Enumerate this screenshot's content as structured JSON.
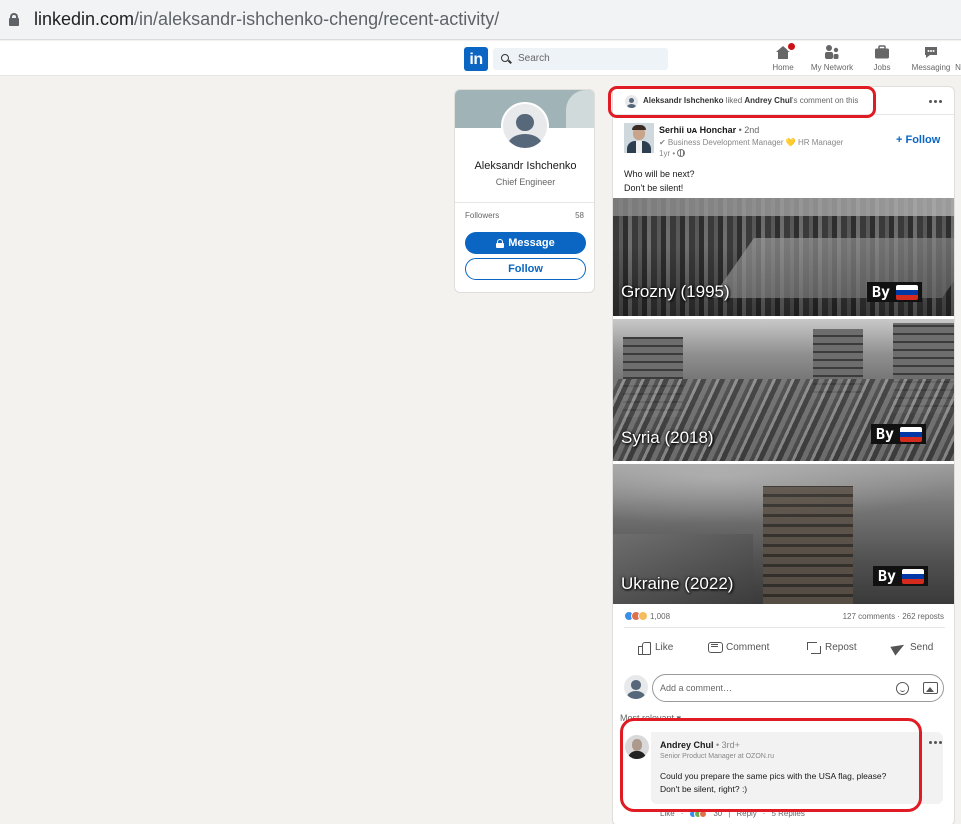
{
  "browser": {
    "url_host": "linkedin.com",
    "url_path": "/in/aleksandr-ishchenko-cheng/recent-activity/"
  },
  "nav": {
    "logo": "in",
    "search_placeholder": "Search",
    "items": [
      {
        "label": "Home",
        "icon": "home-icon",
        "badge": true
      },
      {
        "label": "My Network",
        "icon": "network-icon"
      },
      {
        "label": "Jobs",
        "icon": "briefcase-icon"
      },
      {
        "label": "Messaging",
        "icon": "messaging-icon"
      },
      {
        "label": "N",
        "icon": ""
      }
    ]
  },
  "profile": {
    "name": "Aleksandr Ishchenko",
    "title": "Chief Engineer",
    "followers_label": "Followers",
    "followers_count": "58",
    "message_label": "Message",
    "follow_label": "Follow"
  },
  "activity": {
    "actor": "Aleksandr Ishchenko",
    "verb": " liked ",
    "target": "Andrey Chul",
    "rest": "'s comment on this"
  },
  "post": {
    "author_name": "Serhii",
    "author_flag": "ᴜᴀ",
    "author_surname": "Honchar",
    "author_degree": " • 2nd",
    "author_headline": "✔ Business Development Manager 💛 HR Manager",
    "time": "1yr • ",
    "follow_label": "+ Follow",
    "text_line1": "Who will be next?",
    "text_line2": "Don't be silent!",
    "images": [
      {
        "caption": "Grozny (1995)",
        "tag": "By"
      },
      {
        "caption": "Syria (2018)",
        "tag": "By"
      },
      {
        "caption": "Ukraine (2022)",
        "tag": "By"
      }
    ],
    "reactions_count": "1,008",
    "comments_reposts": "127 comments · 262 reposts",
    "actions": [
      "Like",
      "Comment",
      "Repost",
      "Send"
    ],
    "comment_placeholder": "Add a comment…",
    "sort_label": "Most relevant ▾"
  },
  "comment": {
    "author": "Andrey Chul",
    "degree": " • 3rd+",
    "headline": "Senior Product Manager at OZON.ru",
    "line1": "Could you prepare the same pics with the USA flag, please?",
    "line2": "Don't be silent, right? :)",
    "foot_like": "Like",
    "foot_count": "30",
    "foot_reply": "Reply",
    "foot_replies": "5 Replies"
  },
  "colors": {
    "brand": "#0a66c2",
    "annotation": "#e01b24",
    "flag_white": "#ffffff",
    "flag_blue": "#0039a6",
    "flag_red": "#d52b1e"
  }
}
